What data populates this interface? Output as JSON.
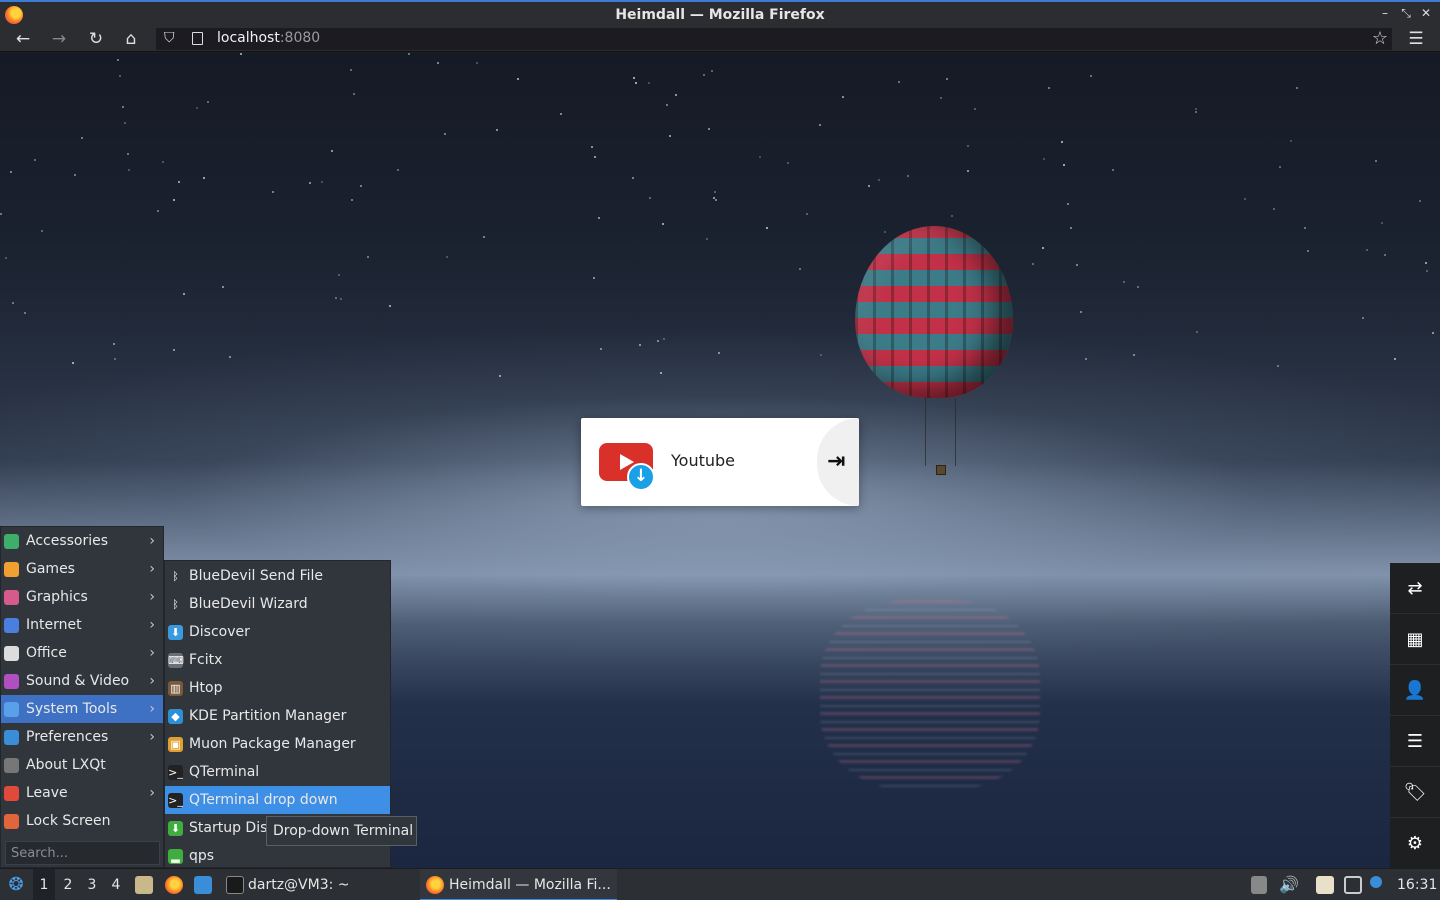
{
  "window": {
    "title": "Heimdall — Mozilla Firefox"
  },
  "browser": {
    "url_host": "localhost",
    "url_port": ":8080",
    "icons": {
      "back": "←",
      "forward": "→",
      "reload": "↻",
      "home": "⌂",
      "shield": "⛉",
      "star": "☆",
      "menu": "☰"
    }
  },
  "tile": {
    "title": "Youtube",
    "go_icon": "⇥"
  },
  "side_toolbar": [
    {
      "name": "switch-icon",
      "glyph": "⇄"
    },
    {
      "name": "grid-icon",
      "glyph": "▦"
    },
    {
      "name": "user-icon",
      "glyph": "👤"
    },
    {
      "name": "list-icon",
      "glyph": "☰"
    },
    {
      "name": "tag-icon",
      "glyph": "🏷"
    },
    {
      "name": "settings-icon",
      "glyph": "⚙"
    }
  ],
  "menu": {
    "items": [
      {
        "label": "Accessories",
        "submenu": true,
        "color": "#3fae6b"
      },
      {
        "label": "Games",
        "submenu": true,
        "color": "#f0a030"
      },
      {
        "label": "Graphics",
        "submenu": true,
        "color": "#d65a8a"
      },
      {
        "label": "Internet",
        "submenu": true,
        "color": "#4a7fe0"
      },
      {
        "label": "Office",
        "submenu": true,
        "color": "#dcdcdc"
      },
      {
        "label": "Sound & Video",
        "submenu": true,
        "color": "#b04fc0"
      },
      {
        "label": "System Tools",
        "submenu": true,
        "selected": true,
        "color": "#5aa0e8"
      },
      {
        "label": "Preferences",
        "submenu": true,
        "color": "#3a8ed8"
      },
      {
        "label": "About LXQt",
        "submenu": false,
        "color": "#777777"
      },
      {
        "label": "Leave",
        "submenu": true,
        "color": "#e04a3a"
      },
      {
        "label": "Lock Screen",
        "submenu": false,
        "color": "#e0653a"
      }
    ],
    "search_placeholder": "Search..."
  },
  "submenu": {
    "items": [
      {
        "label": "BlueDevil Send File",
        "icon": "ᛒ",
        "color": "#31363d"
      },
      {
        "label": "BlueDevil Wizard",
        "icon": "ᛒ",
        "color": "#31363d"
      },
      {
        "label": "Discover",
        "icon": "⬇",
        "color": "#3a9ae0"
      },
      {
        "label": "Fcitx",
        "icon": "⌨",
        "color": "#6a6f76"
      },
      {
        "label": "Htop",
        "icon": "▥",
        "color": "#7a5a3a"
      },
      {
        "label": "KDE Partition Manager",
        "icon": "◆",
        "color": "#2d8fd5"
      },
      {
        "label": "Muon Package Manager",
        "icon": "▣",
        "color": "#e0a030"
      },
      {
        "label": "QTerminal",
        "icon": ">_",
        "color": "#222222"
      },
      {
        "label": "QTerminal drop down",
        "icon": ">_",
        "color": "#222222",
        "selected": true
      },
      {
        "label": "Startup Dis",
        "icon": "⬇",
        "color": "#3fae3f"
      },
      {
        "label": "qps",
        "icon": "▂",
        "color": "#3fae3f"
      }
    ]
  },
  "tooltip": "Drop-down Terminal",
  "taskbar": {
    "desktops": [
      "1",
      "2",
      "3",
      "4"
    ],
    "terminal_task": "dartz@VM3: ~",
    "firefox_task": "Heimdall — Mozilla Fi...",
    "clock": "16:31"
  }
}
